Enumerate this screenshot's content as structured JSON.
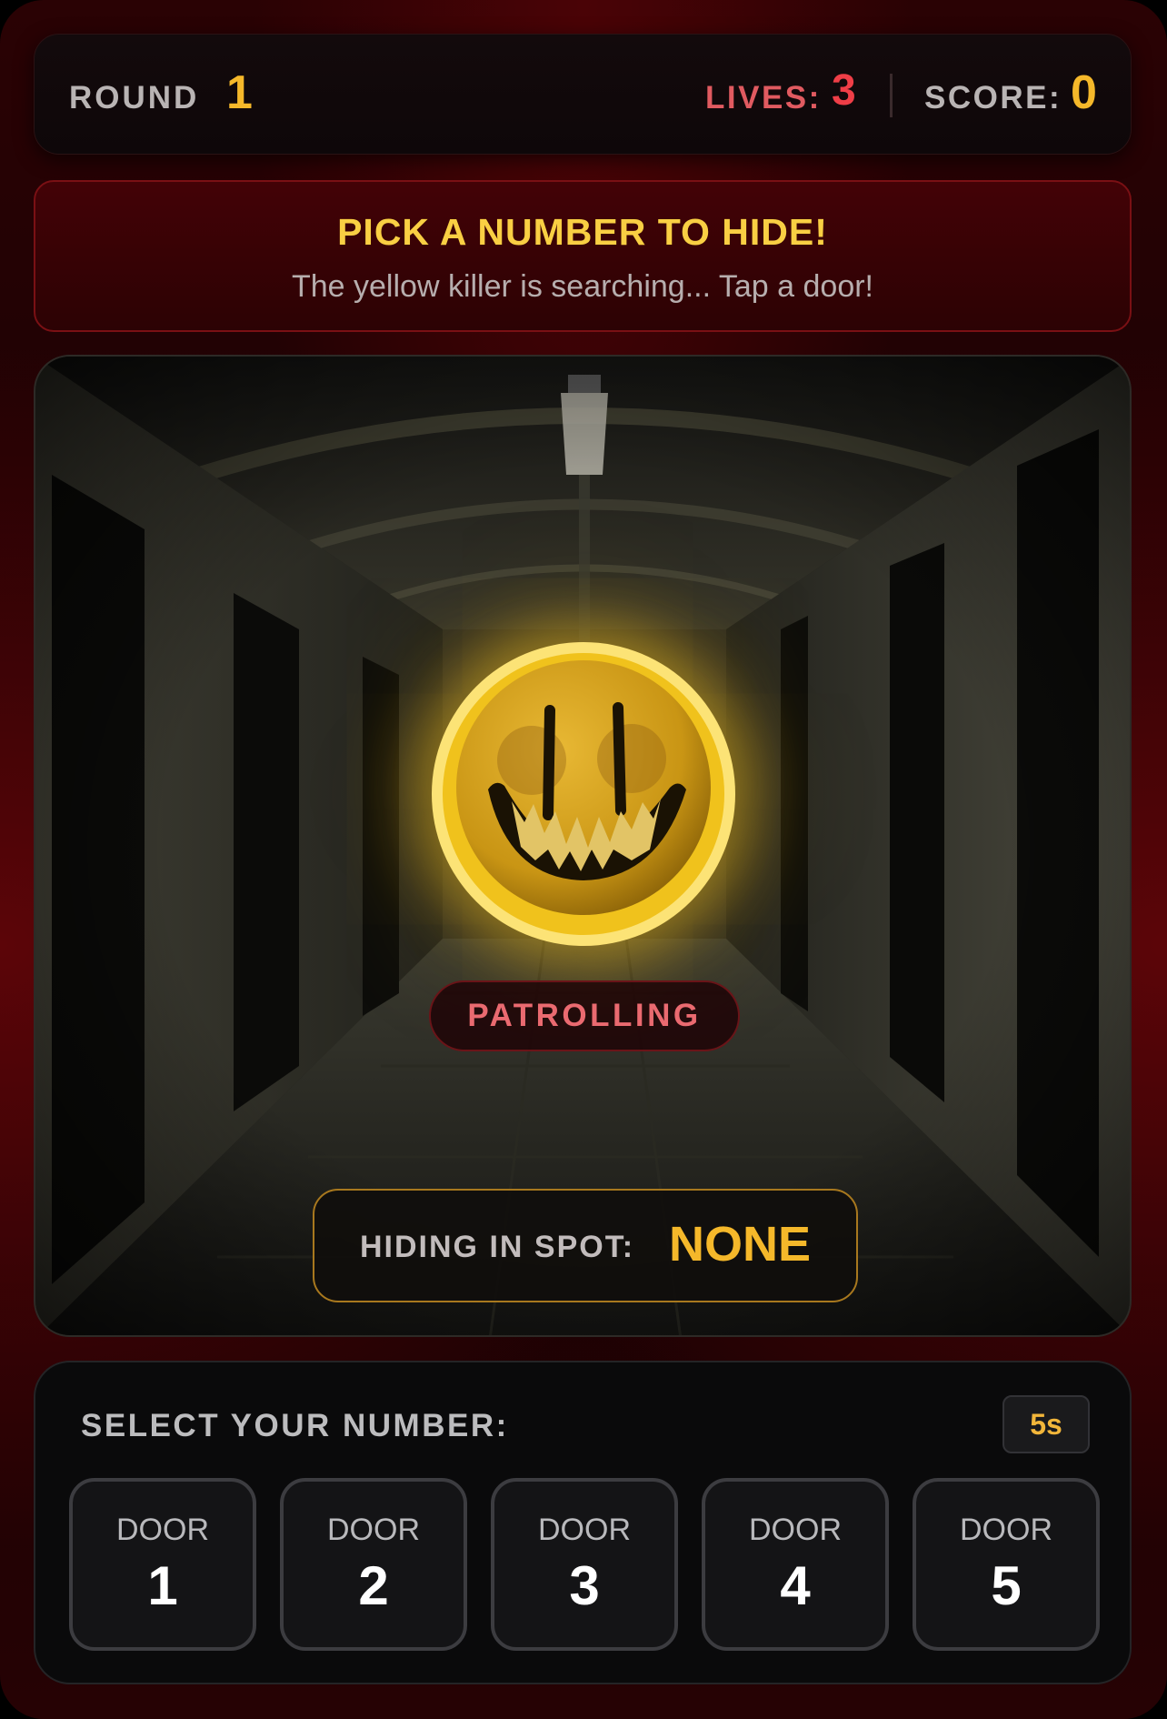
{
  "hud": {
    "round_label": "ROUND",
    "round_value": "1",
    "lives_label": "LIVES:",
    "lives_value": "3",
    "score_label": "SCORE:",
    "score_value": "0"
  },
  "banner": {
    "title": "PICK A NUMBER TO HIDE!",
    "subtitle": "The yellow killer is searching... Tap a door!"
  },
  "scene": {
    "killer_icon": "evil-smiley-icon",
    "status": "PATROLLING",
    "hiding_label": "HIDING IN SPOT:",
    "hiding_value": "NONE"
  },
  "select": {
    "title": "SELECT YOUR NUMBER:",
    "timer": "5s",
    "doors": [
      {
        "label": "DOOR",
        "number": "1"
      },
      {
        "label": "DOOR",
        "number": "2"
      },
      {
        "label": "DOOR",
        "number": "3"
      },
      {
        "label": "DOOR",
        "number": "4"
      },
      {
        "label": "DOOR",
        "number": "5"
      }
    ]
  },
  "colors": {
    "accent_yellow": "#f5b82a",
    "lives_red": "#ef3e47",
    "banner_red": "#430206",
    "status_red": "#ea6a70"
  }
}
